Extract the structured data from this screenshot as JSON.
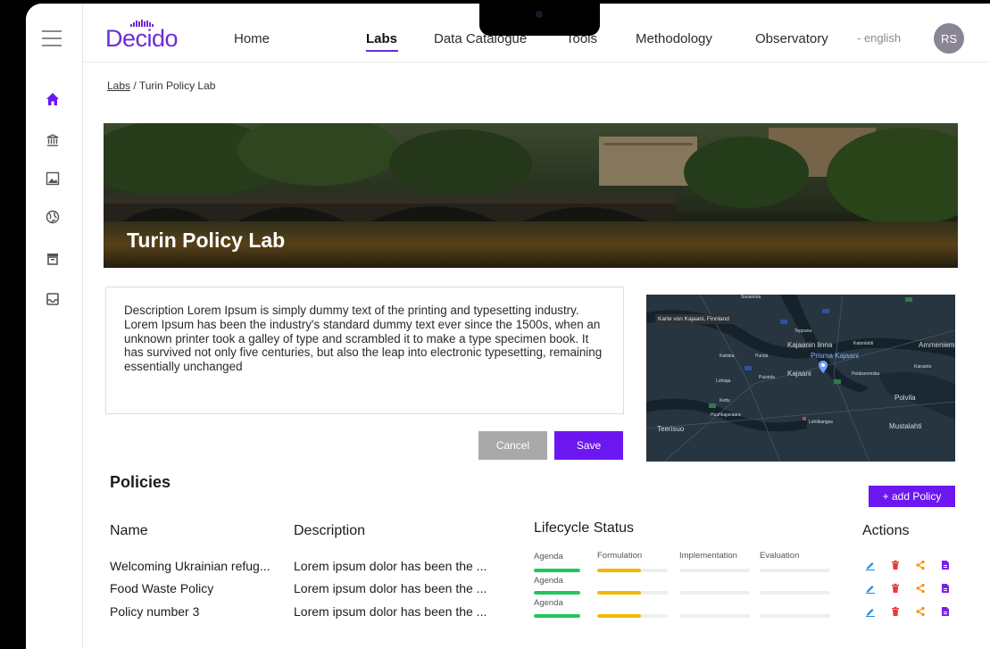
{
  "brand": {
    "logo": "Decido",
    "accent": "#6f2bd6"
  },
  "nav": {
    "items": [
      {
        "label": "Home"
      },
      {
        "label": "Labs"
      },
      {
        "label": "Data Catalogue"
      },
      {
        "label": "Tools"
      },
      {
        "label": "Methodology"
      },
      {
        "label": "Observatory"
      }
    ],
    "active": "Labs",
    "language": "- english",
    "avatar_initials": "RS"
  },
  "sidebar": {
    "icons": [
      "hamburger-icon",
      "home-icon",
      "bank-icon",
      "image-icon",
      "globe-icon",
      "archive-icon",
      "inbox-icon"
    ],
    "active": "home-icon"
  },
  "breadcrumb": {
    "parent": "Labs",
    "separator": " / ",
    "current": "Turin Policy Lab"
  },
  "hero": {
    "title": "Turin Policy Lab"
  },
  "description": {
    "text": "Description Lorem Ipsum is simply dummy text of the printing and typesetting industry. Lorem Ipsum has been the industry's standard dummy text ever since the 1500s, when an unknown printer took a galley of type and scrambled it to make a type specimen book. It has survived not only five centuries, but also the leap into electronic typesetting, remaining essentially unchanged"
  },
  "buttons": {
    "cancel": "Cancel",
    "save": "Save",
    "add_policy": "+ add Policy"
  },
  "map": {
    "title": "Karte von Kajaani, Finnland",
    "labels": [
      "Kajaanin linna",
      "Prisma Kajaani",
      "Kajaani",
      "Polvila",
      "Mustalahti",
      "Teerisuo",
      "Ammeniemi",
      "Purola",
      "Katiska",
      "Lohtaja",
      "Puistola",
      "Kettu",
      "Huuhkajavaara",
      "Teppana",
      "Kaivanto",
      "Lehtikangas",
      "Petäisenniska",
      "Suvantola",
      "Katonlahti"
    ]
  },
  "policies": {
    "title": "Policies",
    "columns": {
      "name": "Name",
      "description": "Description",
      "lifecycle": "Lifecycle Status",
      "actions": "Actions"
    },
    "stages": [
      "Agenda",
      "Formulation",
      "Implementation",
      "Evaluation"
    ],
    "stage_colors": {
      "agenda": "#22c55e",
      "formulation": "#f5b800",
      "empty": "#eeeeee"
    },
    "rows": [
      {
        "name": "Welcoming Ukrainian refug...",
        "description": "Lorem ipsum dolor has been the ...",
        "progress": [
          1.0,
          0.62,
          0,
          0
        ]
      },
      {
        "name": "Food Waste Policy",
        "description": "Lorem ipsum dolor has been the ...",
        "progress": [
          1.0,
          0.62,
          0,
          0
        ]
      },
      {
        "name": "Policy number 3",
        "description": "Lorem ipsum dolor has been the ...",
        "progress": [
          1.0,
          0.62,
          0,
          0
        ]
      }
    ],
    "action_icons": [
      "edit-icon",
      "delete-icon",
      "share-icon",
      "document-icon"
    ],
    "action_colors": {
      "edit": "#1e88e5",
      "delete": "#e53935",
      "share": "#fb8c00",
      "document": "#7b1fe8"
    }
  }
}
